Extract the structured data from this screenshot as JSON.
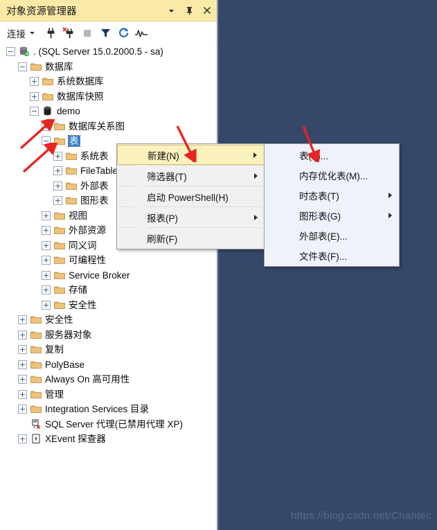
{
  "window": {
    "title": "对象资源管理器",
    "buttons": [
      {
        "name": "dropdown",
        "glyph": "▾"
      },
      {
        "name": "auto-hide-pin",
        "glyph": "pin"
      },
      {
        "name": "close",
        "glyph": "✕"
      }
    ]
  },
  "toolbar": {
    "connect_label": "连接",
    "connect_caret": "▾",
    "icons": [
      {
        "name": "connect-plug-icon",
        "title": "连接"
      },
      {
        "name": "disconnect-plug-icon",
        "title": "断开连接"
      },
      {
        "name": "stop-icon",
        "title": "停止"
      },
      {
        "name": "filter-icon",
        "title": "筛选器"
      },
      {
        "name": "refresh-icon",
        "title": "刷新"
      },
      {
        "name": "activity-monitor-icon",
        "title": "活动监视器"
      }
    ]
  },
  "tree": [
    {
      "label": ". (SQL Server 15.0.2000.5 - sa)",
      "indent": 0,
      "expander": "minus",
      "icon": "server-icon"
    },
    {
      "label": "数据库",
      "indent": 1,
      "expander": "minus",
      "icon": "folder-icon"
    },
    {
      "label": "系统数据库",
      "indent": 2,
      "expander": "plus",
      "icon": "folder-icon"
    },
    {
      "label": "数据库快照",
      "indent": 2,
      "expander": "plus",
      "icon": "folder-icon"
    },
    {
      "label": "demo",
      "indent": 2,
      "expander": "minus",
      "icon": "database-icon"
    },
    {
      "label": "数据库关系图",
      "indent": 3,
      "expander": "plus",
      "icon": "folder-icon"
    },
    {
      "label": "表",
      "indent": 3,
      "expander": "minus",
      "icon": "folder-icon",
      "selected": true
    },
    {
      "label": "系统表",
      "indent": 4,
      "expander": "plus",
      "icon": "folder-icon"
    },
    {
      "label": "FileTable",
      "indent": 4,
      "expander": "plus",
      "icon": "folder-icon"
    },
    {
      "label": "外部表",
      "indent": 4,
      "expander": "plus",
      "icon": "folder-icon"
    },
    {
      "label": "图形表",
      "indent": 4,
      "expander": "plus",
      "icon": "folder-icon"
    },
    {
      "label": "视图",
      "indent": 3,
      "expander": "plus",
      "icon": "folder-icon"
    },
    {
      "label": "外部资源",
      "indent": 3,
      "expander": "plus",
      "icon": "folder-icon"
    },
    {
      "label": "同义词",
      "indent": 3,
      "expander": "plus",
      "icon": "folder-icon"
    },
    {
      "label": "可编程性",
      "indent": 3,
      "expander": "plus",
      "icon": "folder-icon"
    },
    {
      "label": "Service Broker",
      "indent": 3,
      "expander": "plus",
      "icon": "folder-icon"
    },
    {
      "label": "存储",
      "indent": 3,
      "expander": "plus",
      "icon": "folder-icon"
    },
    {
      "label": "安全性",
      "indent": 3,
      "expander": "plus",
      "icon": "folder-icon"
    },
    {
      "label": "安全性",
      "indent": 1,
      "expander": "plus",
      "icon": "folder-icon"
    },
    {
      "label": "服务器对象",
      "indent": 1,
      "expander": "plus",
      "icon": "folder-icon"
    },
    {
      "label": "复制",
      "indent": 1,
      "expander": "plus",
      "icon": "folder-icon"
    },
    {
      "label": "PolyBase",
      "indent": 1,
      "expander": "plus",
      "icon": "folder-icon"
    },
    {
      "label": "Always On 高可用性",
      "indent": 1,
      "expander": "plus",
      "icon": "folder-icon"
    },
    {
      "label": "管理",
      "indent": 1,
      "expander": "plus",
      "icon": "folder-icon"
    },
    {
      "label": "Integration Services 目录",
      "indent": 1,
      "expander": "plus",
      "icon": "folder-icon"
    },
    {
      "label": "SQL Server 代理(已禁用代理 XP)",
      "indent": 1,
      "expander": "none",
      "icon": "agent-disabled-icon"
    },
    {
      "label": "XEvent 探查器",
      "indent": 1,
      "expander": "plus",
      "icon": "xevent-icon"
    }
  ],
  "context_menu": {
    "items": [
      {
        "label": "新建(N)",
        "submenu": true,
        "highlighted": true,
        "separator_after": true
      },
      {
        "label": "筛选器(T)",
        "submenu": true,
        "separator_after": true
      },
      {
        "label": "启动 PowerShell(H)",
        "submenu": false,
        "separator_after": true
      },
      {
        "label": "报表(P)",
        "submenu": true,
        "separator_after": true
      },
      {
        "label": "刷新(F)",
        "submenu": false,
        "separator_after": false
      }
    ]
  },
  "submenu": {
    "items": [
      {
        "label": "表(T)...",
        "submenu": false
      },
      {
        "label": "内存优化表(M)...",
        "submenu": false
      },
      {
        "label": "时态表(T)",
        "submenu": true
      },
      {
        "label": "图形表(G)",
        "submenu": true
      },
      {
        "label": "外部表(E)...",
        "submenu": false
      },
      {
        "label": "文件表(F)...",
        "submenu": false
      }
    ]
  },
  "annotations": {
    "arrows": [
      {
        "name": "arrow-demo-node",
        "target": "demo"
      },
      {
        "name": "arrow-tables-node",
        "target": "表"
      },
      {
        "name": "arrow-new-menu",
        "target": "新建(N)"
      },
      {
        "name": "arrow-table-submenu",
        "target": "表(T)..."
      }
    ]
  },
  "watermark": {
    "text": "https://blog.csdn.net/Chantec"
  },
  "colors": {
    "desktop_background": "#35486a",
    "titlebar": "#fbe9a8",
    "menu_highlight": "#fcf2bd",
    "selection": "#2f7fd0",
    "folder": "#e8b96a",
    "arrow_red": "#e8251f"
  }
}
